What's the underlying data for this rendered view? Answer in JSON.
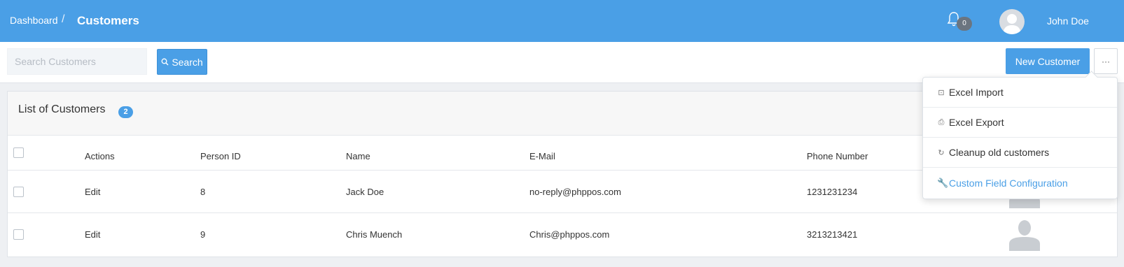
{
  "header": {
    "breadcrumb_home": "Dashboard",
    "breadcrumb_sep": "/",
    "breadcrumb_current": "Customers",
    "notification_count": "0",
    "user_name": "John Doe"
  },
  "toolbar": {
    "search_placeholder": "Search Customers",
    "search_value": "",
    "search_label": "Search",
    "new_customer_label": "New Customer",
    "more_label": "···"
  },
  "panel": {
    "title": "List of Customers",
    "count": "2"
  },
  "table": {
    "columns": [
      "Actions",
      "Person ID",
      "Name",
      "E-Mail",
      "Phone Number"
    ],
    "rows": [
      {
        "action": "Edit",
        "person_id": "8",
        "name": "Jack Doe",
        "email": "no-reply@phppos.com",
        "phone": "1231231234"
      },
      {
        "action": "Edit",
        "person_id": "9",
        "name": "Chris Muench",
        "email": "Chris@phppos.com",
        "phone": "3213213421"
      }
    ]
  },
  "menu": {
    "items": [
      {
        "label": "Excel Import",
        "icon": "import-icon"
      },
      {
        "label": "Excel Export",
        "icon": "export-icon"
      },
      {
        "label": "Cleanup old customers",
        "icon": "refresh-icon"
      },
      {
        "label": "Custom Field Configuration",
        "icon": "wrench-icon"
      }
    ]
  },
  "colors": {
    "header_bg": "#4a9fe6",
    "accent": "#4a9fe6",
    "link": "#4a80c0"
  }
}
